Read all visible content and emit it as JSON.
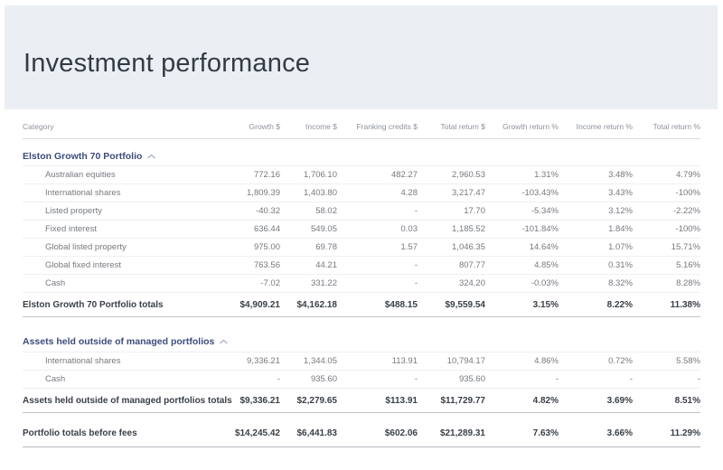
{
  "page": {
    "title": "Investment performance"
  },
  "colors": {
    "hero_background": "#ebeff3",
    "section_header_text": "#3c4c7c",
    "chevron": "#b3bfd4",
    "data_text": "#75797f",
    "totals_text": "#3a4048"
  },
  "table": {
    "columns": [
      "Category",
      "Growth $",
      "Income $",
      "Franking credits $",
      "Total return $",
      "Growth return %",
      "Income return %",
      "Total return %"
    ],
    "sections": [
      {
        "name": "Elston Growth 70 Portfolio",
        "collapse_icon": "chevron-up-icon",
        "rows": [
          [
            "Australian equities",
            "772.16",
            "1,706.10",
            "482.27",
            "2,960.53",
            "1.31%",
            "3.48%",
            "4.79%"
          ],
          [
            "International shares",
            "1,809.39",
            "1,403.80",
            "4.28",
            "3,217.47",
            "-103.43%",
            "3.43%",
            "-100%"
          ],
          [
            "Listed property",
            "-40.32",
            "58.02",
            "-",
            "17.70",
            "-5.34%",
            "3.12%",
            "-2.22%"
          ],
          [
            "Fixed interest",
            "636.44",
            "549.05",
            "0.03",
            "1,185.52",
            "-101.84%",
            "1.84%",
            "-100%"
          ],
          [
            "Global listed property",
            "975.00",
            "69.78",
            "1.57",
            "1,046.35",
            "14.64%",
            "1.07%",
            "15.71%"
          ],
          [
            "Global fixed interest",
            "763.56",
            "44.21",
            "-",
            "807.77",
            "4.85%",
            "0.31%",
            "5.16%"
          ],
          [
            "Cash",
            "-7.02",
            "331.22",
            "-",
            "324.20",
            "-0.03%",
            "8.32%",
            "8.28%"
          ]
        ],
        "totals": [
          "Elston Growth 70 Portfolio totals",
          "$4,909.21",
          "$4,162.18",
          "$488.15",
          "$9,559.54",
          "3.15%",
          "8.22%",
          "11.38%"
        ]
      },
      {
        "name": "Assets held outside of managed portfolios",
        "collapse_icon": "chevron-up-icon",
        "rows": [
          [
            "International shares",
            "9,336.21",
            "1,344.05",
            "113.91",
            "10,794.17",
            "4.86%",
            "0.72%",
            "5.58%"
          ],
          [
            "Cash",
            "-",
            "935.60",
            "-",
            "935.60",
            "-",
            "-",
            "-"
          ]
        ],
        "totals": [
          "Assets held outside of managed portfolios totals",
          "$9,336.21",
          "$2,279.65",
          "$113.91",
          "$11,729.77",
          "4.82%",
          "3.69%",
          "8.51%"
        ]
      }
    ],
    "grand_total": [
      "Portfolio totals before fees",
      "$14,245.42",
      "$6,441.83",
      "$602.06",
      "$21,289.31",
      "7.63%",
      "3.66%",
      "11.29%"
    ]
  }
}
